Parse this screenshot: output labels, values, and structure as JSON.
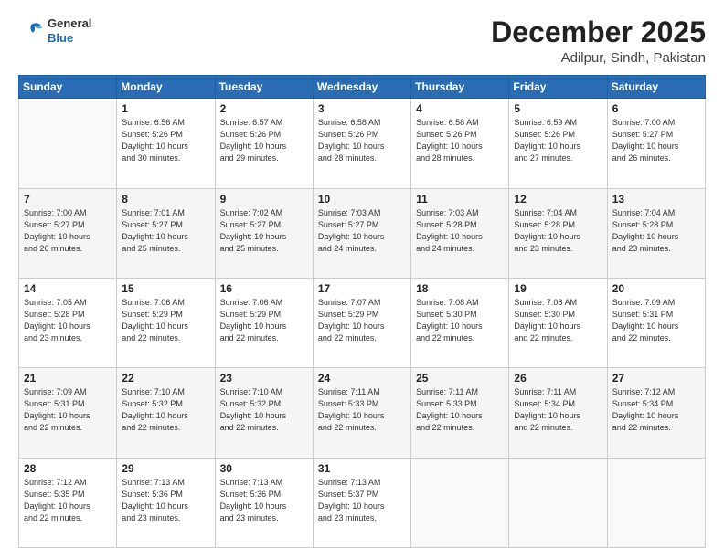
{
  "logo": {
    "line1": "General",
    "line2": "Blue"
  },
  "header": {
    "month": "December 2025",
    "location": "Adilpur, Sindh, Pakistan"
  },
  "weekdays": [
    "Sunday",
    "Monday",
    "Tuesday",
    "Wednesday",
    "Thursday",
    "Friday",
    "Saturday"
  ],
  "weeks": [
    [
      {
        "day": "",
        "info": ""
      },
      {
        "day": "1",
        "info": "Sunrise: 6:56 AM\nSunset: 5:26 PM\nDaylight: 10 hours\nand 30 minutes."
      },
      {
        "day": "2",
        "info": "Sunrise: 6:57 AM\nSunset: 5:26 PM\nDaylight: 10 hours\nand 29 minutes."
      },
      {
        "day": "3",
        "info": "Sunrise: 6:58 AM\nSunset: 5:26 PM\nDaylight: 10 hours\nand 28 minutes."
      },
      {
        "day": "4",
        "info": "Sunrise: 6:58 AM\nSunset: 5:26 PM\nDaylight: 10 hours\nand 28 minutes."
      },
      {
        "day": "5",
        "info": "Sunrise: 6:59 AM\nSunset: 5:26 PM\nDaylight: 10 hours\nand 27 minutes."
      },
      {
        "day": "6",
        "info": "Sunrise: 7:00 AM\nSunset: 5:27 PM\nDaylight: 10 hours\nand 26 minutes."
      }
    ],
    [
      {
        "day": "7",
        "info": "Sunrise: 7:00 AM\nSunset: 5:27 PM\nDaylight: 10 hours\nand 26 minutes."
      },
      {
        "day": "8",
        "info": "Sunrise: 7:01 AM\nSunset: 5:27 PM\nDaylight: 10 hours\nand 25 minutes."
      },
      {
        "day": "9",
        "info": "Sunrise: 7:02 AM\nSunset: 5:27 PM\nDaylight: 10 hours\nand 25 minutes."
      },
      {
        "day": "10",
        "info": "Sunrise: 7:03 AM\nSunset: 5:27 PM\nDaylight: 10 hours\nand 24 minutes."
      },
      {
        "day": "11",
        "info": "Sunrise: 7:03 AM\nSunset: 5:28 PM\nDaylight: 10 hours\nand 24 minutes."
      },
      {
        "day": "12",
        "info": "Sunrise: 7:04 AM\nSunset: 5:28 PM\nDaylight: 10 hours\nand 23 minutes."
      },
      {
        "day": "13",
        "info": "Sunrise: 7:04 AM\nSunset: 5:28 PM\nDaylight: 10 hours\nand 23 minutes."
      }
    ],
    [
      {
        "day": "14",
        "info": "Sunrise: 7:05 AM\nSunset: 5:28 PM\nDaylight: 10 hours\nand 23 minutes."
      },
      {
        "day": "15",
        "info": "Sunrise: 7:06 AM\nSunset: 5:29 PM\nDaylight: 10 hours\nand 22 minutes."
      },
      {
        "day": "16",
        "info": "Sunrise: 7:06 AM\nSunset: 5:29 PM\nDaylight: 10 hours\nand 22 minutes."
      },
      {
        "day": "17",
        "info": "Sunrise: 7:07 AM\nSunset: 5:29 PM\nDaylight: 10 hours\nand 22 minutes."
      },
      {
        "day": "18",
        "info": "Sunrise: 7:08 AM\nSunset: 5:30 PM\nDaylight: 10 hours\nand 22 minutes."
      },
      {
        "day": "19",
        "info": "Sunrise: 7:08 AM\nSunset: 5:30 PM\nDaylight: 10 hours\nand 22 minutes."
      },
      {
        "day": "20",
        "info": "Sunrise: 7:09 AM\nSunset: 5:31 PM\nDaylight: 10 hours\nand 22 minutes."
      }
    ],
    [
      {
        "day": "21",
        "info": "Sunrise: 7:09 AM\nSunset: 5:31 PM\nDaylight: 10 hours\nand 22 minutes."
      },
      {
        "day": "22",
        "info": "Sunrise: 7:10 AM\nSunset: 5:32 PM\nDaylight: 10 hours\nand 22 minutes."
      },
      {
        "day": "23",
        "info": "Sunrise: 7:10 AM\nSunset: 5:32 PM\nDaylight: 10 hours\nand 22 minutes."
      },
      {
        "day": "24",
        "info": "Sunrise: 7:11 AM\nSunset: 5:33 PM\nDaylight: 10 hours\nand 22 minutes."
      },
      {
        "day": "25",
        "info": "Sunrise: 7:11 AM\nSunset: 5:33 PM\nDaylight: 10 hours\nand 22 minutes."
      },
      {
        "day": "26",
        "info": "Sunrise: 7:11 AM\nSunset: 5:34 PM\nDaylight: 10 hours\nand 22 minutes."
      },
      {
        "day": "27",
        "info": "Sunrise: 7:12 AM\nSunset: 5:34 PM\nDaylight: 10 hours\nand 22 minutes."
      }
    ],
    [
      {
        "day": "28",
        "info": "Sunrise: 7:12 AM\nSunset: 5:35 PM\nDaylight: 10 hours\nand 22 minutes."
      },
      {
        "day": "29",
        "info": "Sunrise: 7:13 AM\nSunset: 5:36 PM\nDaylight: 10 hours\nand 23 minutes."
      },
      {
        "day": "30",
        "info": "Sunrise: 7:13 AM\nSunset: 5:36 PM\nDaylight: 10 hours\nand 23 minutes."
      },
      {
        "day": "31",
        "info": "Sunrise: 7:13 AM\nSunset: 5:37 PM\nDaylight: 10 hours\nand 23 minutes."
      },
      {
        "day": "",
        "info": ""
      },
      {
        "day": "",
        "info": ""
      },
      {
        "day": "",
        "info": ""
      }
    ]
  ]
}
